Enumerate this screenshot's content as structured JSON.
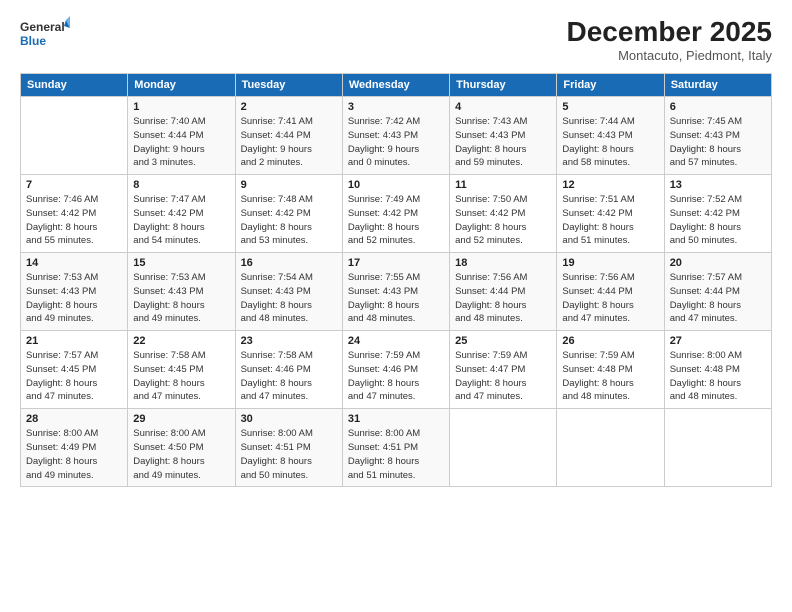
{
  "logo": {
    "line1": "General",
    "line2": "Blue"
  },
  "title": "December 2025",
  "location": "Montacuto, Piedmont, Italy",
  "weekdays": [
    "Sunday",
    "Monday",
    "Tuesday",
    "Wednesday",
    "Thursday",
    "Friday",
    "Saturday"
  ],
  "weeks": [
    [
      {
        "day": "",
        "info": ""
      },
      {
        "day": "1",
        "info": "Sunrise: 7:40 AM\nSunset: 4:44 PM\nDaylight: 9 hours\nand 3 minutes."
      },
      {
        "day": "2",
        "info": "Sunrise: 7:41 AM\nSunset: 4:44 PM\nDaylight: 9 hours\nand 2 minutes."
      },
      {
        "day": "3",
        "info": "Sunrise: 7:42 AM\nSunset: 4:43 PM\nDaylight: 9 hours\nand 0 minutes."
      },
      {
        "day": "4",
        "info": "Sunrise: 7:43 AM\nSunset: 4:43 PM\nDaylight: 8 hours\nand 59 minutes."
      },
      {
        "day": "5",
        "info": "Sunrise: 7:44 AM\nSunset: 4:43 PM\nDaylight: 8 hours\nand 58 minutes."
      },
      {
        "day": "6",
        "info": "Sunrise: 7:45 AM\nSunset: 4:43 PM\nDaylight: 8 hours\nand 57 minutes."
      }
    ],
    [
      {
        "day": "7",
        "info": "Sunrise: 7:46 AM\nSunset: 4:42 PM\nDaylight: 8 hours\nand 55 minutes."
      },
      {
        "day": "8",
        "info": "Sunrise: 7:47 AM\nSunset: 4:42 PM\nDaylight: 8 hours\nand 54 minutes."
      },
      {
        "day": "9",
        "info": "Sunrise: 7:48 AM\nSunset: 4:42 PM\nDaylight: 8 hours\nand 53 minutes."
      },
      {
        "day": "10",
        "info": "Sunrise: 7:49 AM\nSunset: 4:42 PM\nDaylight: 8 hours\nand 52 minutes."
      },
      {
        "day": "11",
        "info": "Sunrise: 7:50 AM\nSunset: 4:42 PM\nDaylight: 8 hours\nand 52 minutes."
      },
      {
        "day": "12",
        "info": "Sunrise: 7:51 AM\nSunset: 4:42 PM\nDaylight: 8 hours\nand 51 minutes."
      },
      {
        "day": "13",
        "info": "Sunrise: 7:52 AM\nSunset: 4:42 PM\nDaylight: 8 hours\nand 50 minutes."
      }
    ],
    [
      {
        "day": "14",
        "info": "Sunrise: 7:53 AM\nSunset: 4:43 PM\nDaylight: 8 hours\nand 49 minutes."
      },
      {
        "day": "15",
        "info": "Sunrise: 7:53 AM\nSunset: 4:43 PM\nDaylight: 8 hours\nand 49 minutes."
      },
      {
        "day": "16",
        "info": "Sunrise: 7:54 AM\nSunset: 4:43 PM\nDaylight: 8 hours\nand 48 minutes."
      },
      {
        "day": "17",
        "info": "Sunrise: 7:55 AM\nSunset: 4:43 PM\nDaylight: 8 hours\nand 48 minutes."
      },
      {
        "day": "18",
        "info": "Sunrise: 7:56 AM\nSunset: 4:44 PM\nDaylight: 8 hours\nand 48 minutes."
      },
      {
        "day": "19",
        "info": "Sunrise: 7:56 AM\nSunset: 4:44 PM\nDaylight: 8 hours\nand 47 minutes."
      },
      {
        "day": "20",
        "info": "Sunrise: 7:57 AM\nSunset: 4:44 PM\nDaylight: 8 hours\nand 47 minutes."
      }
    ],
    [
      {
        "day": "21",
        "info": "Sunrise: 7:57 AM\nSunset: 4:45 PM\nDaylight: 8 hours\nand 47 minutes."
      },
      {
        "day": "22",
        "info": "Sunrise: 7:58 AM\nSunset: 4:45 PM\nDaylight: 8 hours\nand 47 minutes."
      },
      {
        "day": "23",
        "info": "Sunrise: 7:58 AM\nSunset: 4:46 PM\nDaylight: 8 hours\nand 47 minutes."
      },
      {
        "day": "24",
        "info": "Sunrise: 7:59 AM\nSunset: 4:46 PM\nDaylight: 8 hours\nand 47 minutes."
      },
      {
        "day": "25",
        "info": "Sunrise: 7:59 AM\nSunset: 4:47 PM\nDaylight: 8 hours\nand 47 minutes."
      },
      {
        "day": "26",
        "info": "Sunrise: 7:59 AM\nSunset: 4:48 PM\nDaylight: 8 hours\nand 48 minutes."
      },
      {
        "day": "27",
        "info": "Sunrise: 8:00 AM\nSunset: 4:48 PM\nDaylight: 8 hours\nand 48 minutes."
      }
    ],
    [
      {
        "day": "28",
        "info": "Sunrise: 8:00 AM\nSunset: 4:49 PM\nDaylight: 8 hours\nand 49 minutes."
      },
      {
        "day": "29",
        "info": "Sunrise: 8:00 AM\nSunset: 4:50 PM\nDaylight: 8 hours\nand 49 minutes."
      },
      {
        "day": "30",
        "info": "Sunrise: 8:00 AM\nSunset: 4:51 PM\nDaylight: 8 hours\nand 50 minutes."
      },
      {
        "day": "31",
        "info": "Sunrise: 8:00 AM\nSunset: 4:51 PM\nDaylight: 8 hours\nand 51 minutes."
      },
      {
        "day": "",
        "info": ""
      },
      {
        "day": "",
        "info": ""
      },
      {
        "day": "",
        "info": ""
      }
    ]
  ]
}
